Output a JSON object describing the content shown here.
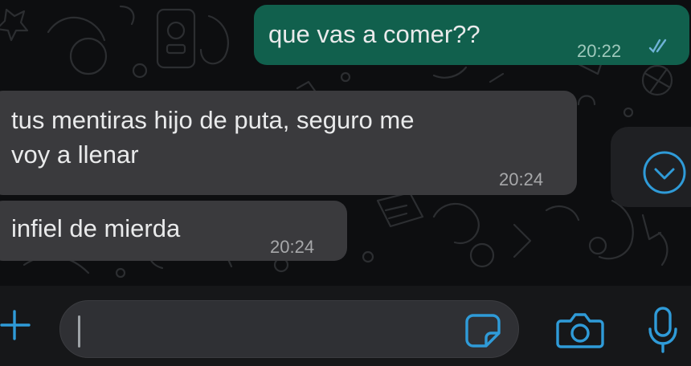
{
  "colors": {
    "chat_background": "#0d0e10",
    "outgoing_bubble": "#11604d",
    "incoming_bubble": "#3a3a3d",
    "accent": "#2f9bd8",
    "composer_background": "#161719"
  },
  "messages": [
    {
      "direction": "outgoing",
      "text": "que vas a comer??",
      "time": "20:22",
      "status_icon": "double-check-icon"
    },
    {
      "direction": "incoming",
      "text_line_1": "tus mentiras hijo de puta, seguro me",
      "text_line_2": "voy a llenar",
      "time": "20:24"
    },
    {
      "direction": "incoming",
      "text": "infiel de mierda",
      "time": "20:24"
    }
  ],
  "scroll_button": {
    "icon": "chevron-down-icon"
  },
  "composer": {
    "value": "",
    "attach_icon": "plus-icon",
    "sticker_icon": "sticker-icon",
    "camera_icon": "camera-icon",
    "mic_icon": "microphone-icon"
  }
}
